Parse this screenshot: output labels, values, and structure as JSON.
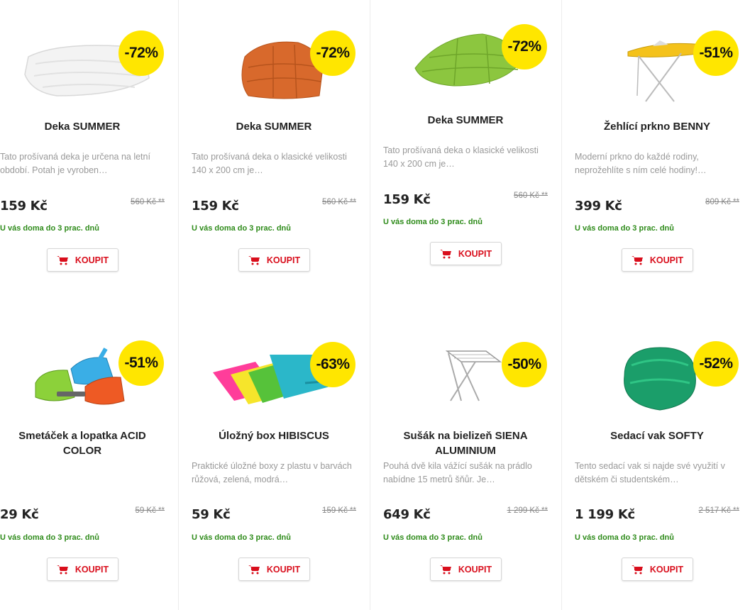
{
  "colors": {
    "badge": "#ffe600",
    "buy": "#d90e1c",
    "delivery": "#2e8b1a"
  },
  "buy_label": "KOUPIT",
  "products": [
    {
      "badge": "-72%",
      "title": "Deka SUMMER",
      "desc1": "Tato prošívaná deka je určena na letní",
      "desc2": "období. Potah je vyroben…",
      "price": "159 Kč",
      "old_price": "560 Kč **",
      "delivery": "U vás doma do 3 prac. dnů",
      "icon": "white-blanket-image"
    },
    {
      "badge": "-72%",
      "title": "Deka SUMMER",
      "desc1": "Tato prošívaná deka o klasické velikosti",
      "desc2": "140 x 200 cm je…",
      "price": "159 Kč",
      "old_price": "560 Kč **",
      "delivery": "U vás doma do 3 prac. dnů",
      "icon": "orange-blanket-image"
    },
    {
      "badge": "-72%",
      "title": "Deka SUMMER",
      "desc1": "Tato prošívaná deka o klasické velikosti",
      "desc2": "140 x 200 cm je…",
      "price": "159 Kč",
      "old_price": "560 Kč **",
      "delivery": "U vás doma do 3 prac. dnů",
      "icon": "green-blanket-image"
    },
    {
      "badge": "-51%",
      "title": "Žehlící prkno BENNY",
      "desc1": "Moderní prkno do každé rodiny,",
      "desc2": "neprožehlíte s ním celé hodiny!…",
      "price": "399 Kč",
      "old_price": "809 Kč **",
      "delivery": "U vás doma do 3 prac. dnů",
      "icon": "ironing-board-image"
    },
    {
      "badge": "-51%",
      "title": "Smetáček a lopatka ACID COLOR",
      "desc1": "",
      "desc2": "",
      "price": "29 Kč",
      "old_price": "59 Kč **",
      "delivery": "U vás doma do 3 prac. dnů",
      "icon": "dustpan-brush-image"
    },
    {
      "badge": "-63%",
      "title": "Úložný box HIBISCUS",
      "desc1": "Praktické úložné boxy z plastu v barvách",
      "desc2": "růžová, zelená, modrá…",
      "price": "59 Kč",
      "old_price": "159 Kč **",
      "delivery": "U vás doma do 3 prac. dnů",
      "icon": "storage-box-image"
    },
    {
      "badge": "-50%",
      "title": "Sušák na bielizeň SIENA ALUMINIUM",
      "desc1": "Pouhá dvě kila vážící sušák na prádlo",
      "desc2": "nabídne 15 metrů šňůr. Je…",
      "price": "649 Kč",
      "old_price": "1 299 Kč **",
      "delivery": "U vás doma do 3 prac. dnů",
      "icon": "clothes-dryer-image"
    },
    {
      "badge": "-52%",
      "title": "Sedací vak SOFTY",
      "desc1": "Tento sedací vak si najde své využití v",
      "desc2": "dětském či studentském…",
      "price": "1 199 Kč",
      "old_price": "2 517 Kč **",
      "delivery": "U vás doma do 3 prac. dnů",
      "icon": "bean-bag-image"
    }
  ]
}
